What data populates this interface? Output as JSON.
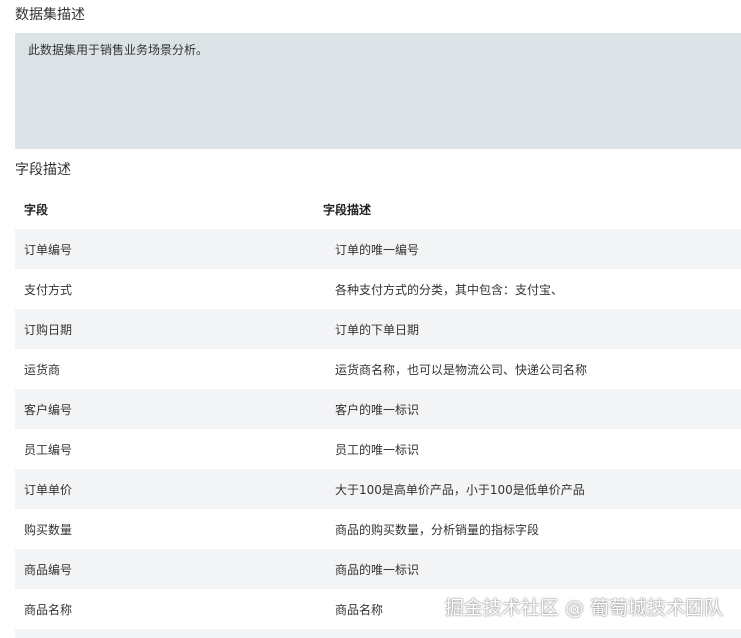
{
  "dataset_section": {
    "title": "数据集描述",
    "description": "此数据集用于销售业务场景分析。"
  },
  "field_section": {
    "title": "字段描述",
    "headers": {
      "field": "字段",
      "description": "字段描述"
    },
    "rows": [
      {
        "field": "订单编号",
        "description": "订单的唯一编号"
      },
      {
        "field": "支付方式",
        "description": "各种支付方式的分类，其中包含：支付宝、"
      },
      {
        "field": "订购日期",
        "description": "订单的下单日期"
      },
      {
        "field": "运货商",
        "description": "运货商名称，也可以是物流公司、快递公司名称"
      },
      {
        "field": "客户编号",
        "description": "客户的唯一标识"
      },
      {
        "field": "员工编号",
        "description": "员工的唯一标识"
      },
      {
        "field": "订单单价",
        "description": "大于100是高单价产品，小于100是低单价产品"
      },
      {
        "field": "购买数量",
        "description": "商品的购买数量，分析销量的指标字段"
      },
      {
        "field": "商品编号",
        "description": "商品的唯一标识"
      },
      {
        "field": "商品名称",
        "description": "商品名称"
      },
      {
        "field": "",
        "description": ""
      }
    ]
  },
  "watermark": "掘金技术社区 @ 葡萄城技术团队"
}
